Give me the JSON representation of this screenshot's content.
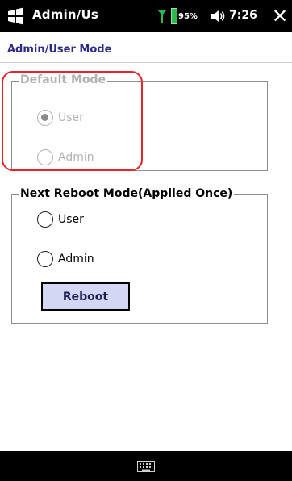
{
  "status_bar": {
    "app_title": "Admin/Us",
    "battery_percent": "95%",
    "time": "7:26",
    "close_label": "✕",
    "icons": [
      "windows-start-icon",
      "signal-icon",
      "battery-icon",
      "speaker-icon",
      "keyboard-icon"
    ]
  },
  "header": {
    "title": "Admin/User Mode"
  },
  "default_mode": {
    "legend": "Default Mode",
    "enabled": false,
    "selected": "User",
    "options": [
      "User",
      "Admin"
    ]
  },
  "next_reboot": {
    "legend": "Next Reboot Mode(Applied Once)",
    "selected": null,
    "options": [
      "User",
      "Admin"
    ],
    "button_label": "Reboot"
  },
  "colors": {
    "title_text": "#2d2a87",
    "button_fill": "#d3d7f3",
    "highlight": "#e5232a",
    "disabled": "#b4b4b4"
  }
}
